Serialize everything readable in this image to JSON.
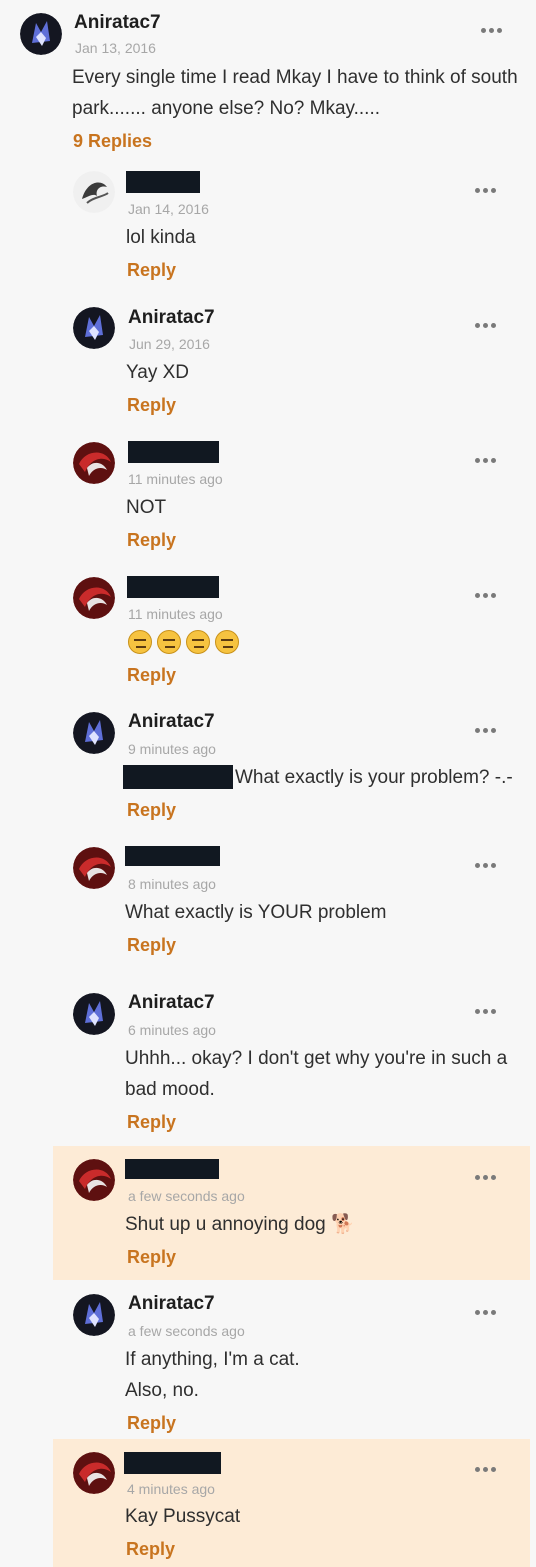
{
  "comment": {
    "author": "Aniratac7",
    "time": "Jan 13, 2016",
    "text_line1": "Every single time I read Mkay I have to think of south",
    "text_line2": "park....... anyone else? No? Mkay.....",
    "replies_count": "9 Replies"
  },
  "replies": [
    {
      "author": "",
      "time": "Jan 14, 2016",
      "text": "lol kinda",
      "reply_label": "Reply"
    },
    {
      "author": "Aniratac7",
      "time": "Jun 29, 2016",
      "text": "Yay XD",
      "reply_label": "Reply"
    },
    {
      "author": "",
      "time": "11 minutes ago",
      "text": "NOT",
      "reply_label": "Reply"
    },
    {
      "author": "",
      "time": "11 minutes ago",
      "text": "",
      "reply_label": "Reply"
    },
    {
      "author": "Aniratac7",
      "time": "9 minutes ago",
      "text": "What exactly is your problem? -.-",
      "reply_label": "Reply"
    },
    {
      "author": "",
      "time": "8 minutes ago",
      "text": "What exactly is YOUR problem",
      "reply_label": "Reply"
    },
    {
      "author": "Aniratac7",
      "time": "6 minutes ago",
      "text_line1": "Uhhh... okay? I don't get why you're in such a",
      "text_line2": "bad mood.",
      "reply_label": "Reply"
    },
    {
      "author": "",
      "time": "a few seconds ago",
      "text": "Shut up u annoying dog 🐕",
      "reply_label": "Reply"
    },
    {
      "author": "Aniratac7",
      "time": "a few seconds ago",
      "text_line1": "If anything, I'm a cat.",
      "text_line2": "Also, no.",
      "reply_label": "Reply"
    },
    {
      "author": "",
      "time": "4 minutes ago",
      "text": "Kay Pussycat",
      "reply_label": "Reply"
    }
  ],
  "colors": {
    "background": "#f7f7f7",
    "highlight": "#fdebd6",
    "reply_accent": "#c8741f",
    "timestamp": "#a7a7a7"
  },
  "icons": {
    "more": "more-options-icon",
    "avatar_fox": "fox-avatar-icon",
    "avatar_red": "red-mask-avatar-icon",
    "avatar_tail": "fairy-tail-avatar-icon",
    "emoji": "expressionless-face-icon"
  }
}
